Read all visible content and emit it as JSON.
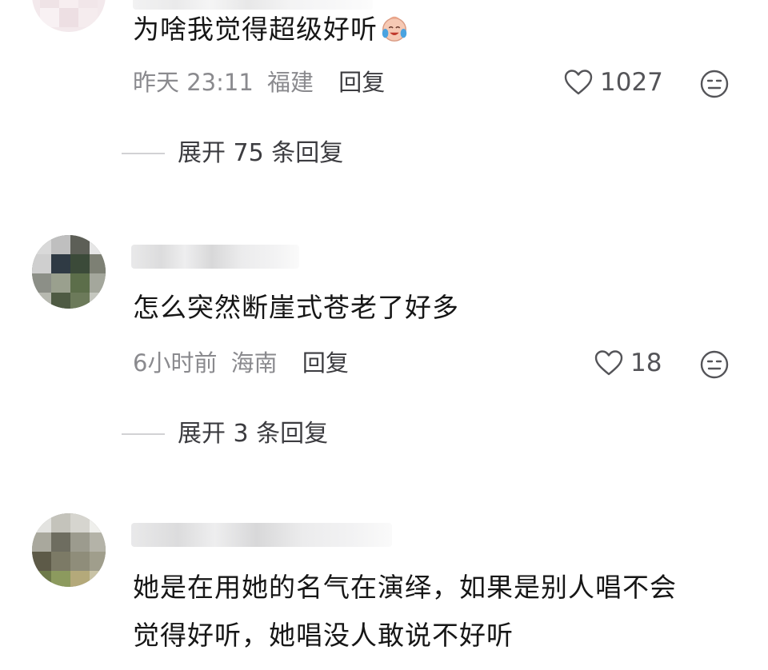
{
  "comments": [
    {
      "text": "为啥我觉得超级好听",
      "emoji": "crying-laughing-face-icon",
      "time": "昨天 23:11",
      "location": "福建",
      "reply_label": "回复",
      "likes": "1027",
      "expand_label": "展开 75 条回复"
    },
    {
      "text": "怎么突然断崖式苍老了好多",
      "time": "6小时前",
      "location": "海南",
      "reply_label": "回复",
      "likes": "18",
      "expand_label": "展开 3 条回复"
    },
    {
      "text_lines": [
        "她是在用她的名气在演绎，如果是别人唱不会",
        "觉得好听，她唱没人敢说不好听"
      ]
    }
  ],
  "icons": {
    "like": "heart-outline-icon",
    "dislike": "neutral-face-icon"
  },
  "colors": {
    "text_primary": "#161616",
    "text_secondary": "#8a8a8e",
    "divider": "#d2d2d4",
    "background": "#ffffff"
  }
}
